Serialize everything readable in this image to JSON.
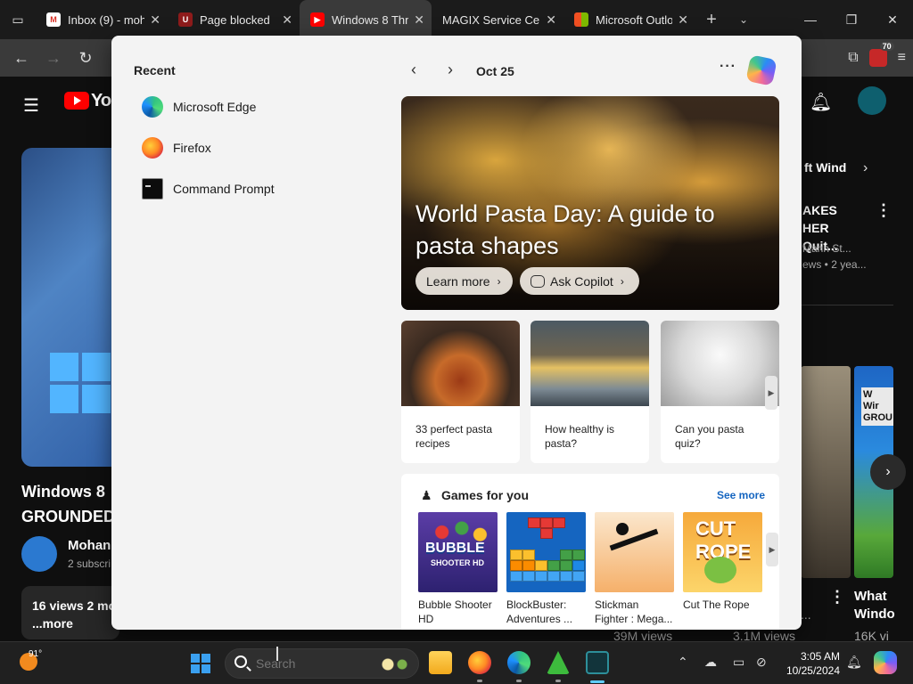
{
  "browser": {
    "tabs": [
      {
        "label": "Inbox (9) - moha",
        "favicon": "gmail-icon",
        "color": "#d93025",
        "active": false
      },
      {
        "label": "Page blocked",
        "favicon": "ublock-icon",
        "color": "#8e1b1b",
        "active": false
      },
      {
        "label": "Windows 8 Thro",
        "favicon": "youtube-icon",
        "color": "#ff0000",
        "active": true
      },
      {
        "label": "MAGIX Service Cent",
        "favicon": "none",
        "color": "#555555",
        "active": false
      },
      {
        "label": "Microsoft Outlo",
        "favicon": "microsoft-icon",
        "color": "#f25022",
        "active": false
      }
    ],
    "extension_badge": "70"
  },
  "youtube": {
    "logo_text": "You",
    "video_title": "Windows 8\nGROUNDED",
    "channel_name": "Mohan",
    "channel_subs": "2 subscri",
    "views_line": "16 views  2 mo",
    "more": "...more",
    "right_chip": "ft Wind",
    "right_title": "AKES\nHER Quit...",
    "right_meta": "Mann St...\news  • 2 yea...",
    "thumb_text": "W\nWir\nGROU",
    "bottom_title": "What\nWindo",
    "views": [
      "39M views",
      "3.1M views",
      "16K vi"
    ],
    "ellipsis": "..."
  },
  "widgets": {
    "recent_title": "Recent",
    "recent_items": [
      {
        "label": "Microsoft Edge",
        "icon": "edge-icon"
      },
      {
        "label": "Firefox",
        "icon": "firefox-icon"
      },
      {
        "label": "Command Prompt",
        "icon": "command-prompt-icon"
      }
    ],
    "date": "Oct 25",
    "hero": {
      "title": "World Pasta Day: A guide to pasta shapes",
      "learn_more": "Learn more",
      "ask_copilot": "Ask Copilot"
    },
    "cards": [
      {
        "label": "33 perfect pasta recipes"
      },
      {
        "label": "How healthy is pasta?"
      },
      {
        "label": "Can you pasta quiz?"
      }
    ],
    "games": {
      "title": "Games for you",
      "see_more": "See more",
      "items": [
        {
          "name": "Bubble Shooter HD",
          "art_title": "BUBBLE",
          "art_sub": "SHOOTER HD"
        },
        {
          "name": "BlockBuster: Adventures ..."
        },
        {
          "name": "Stickman Fighter : Mega..."
        },
        {
          "name": "Cut The Rope",
          "art_title": "CUT ROPE"
        }
      ]
    }
  },
  "taskbar": {
    "weather_temp": "91°",
    "search_placeholder": "Search",
    "time": "3:05 AM",
    "date": "10/25/2024"
  }
}
